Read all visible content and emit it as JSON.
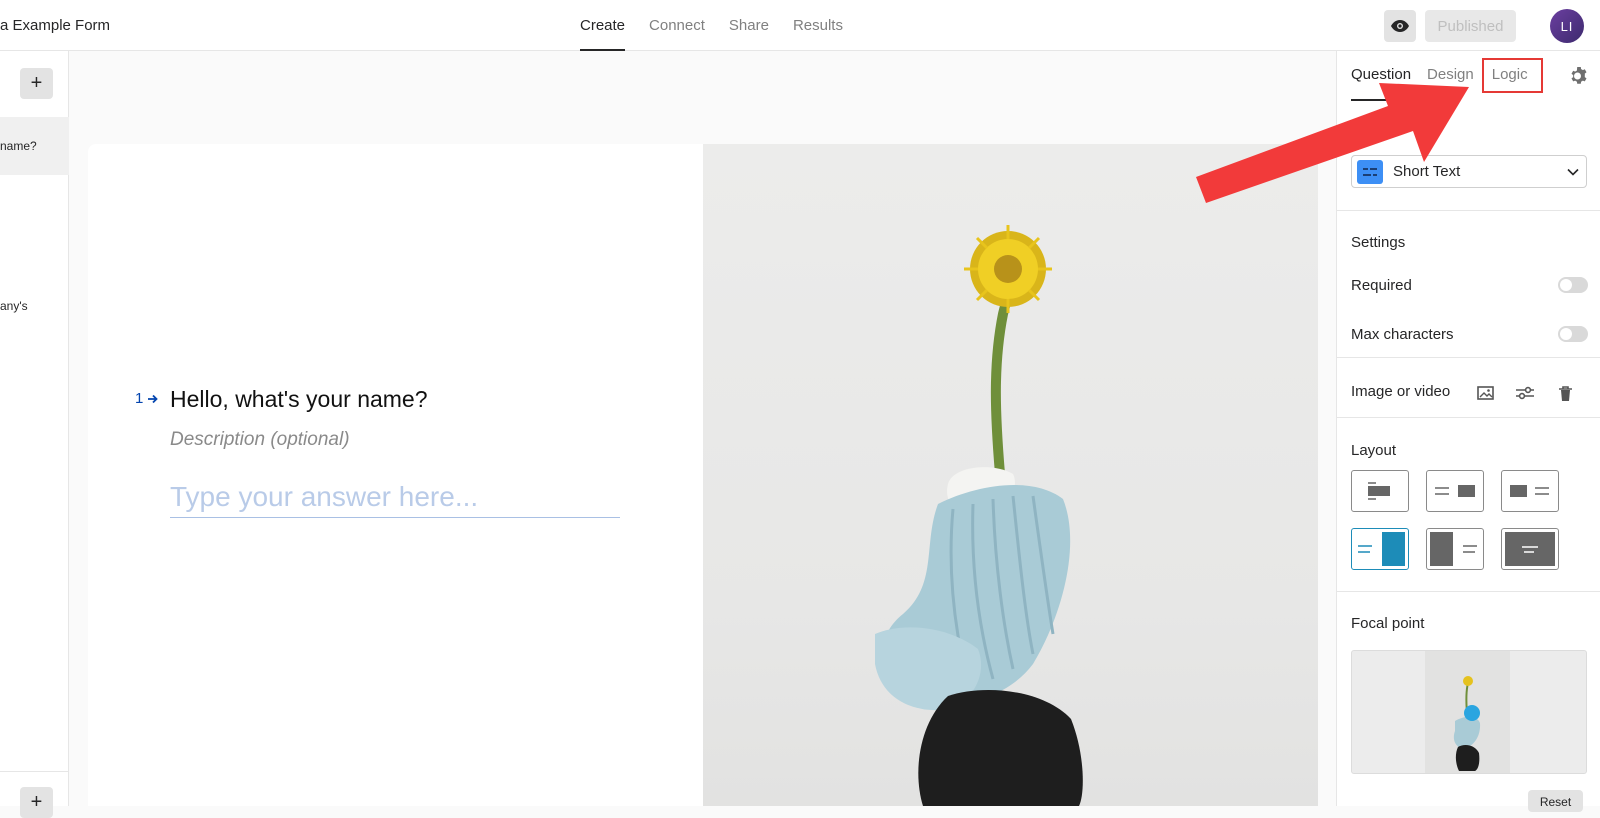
{
  "header": {
    "form_title": "a Example Form",
    "tabs": [
      {
        "label": "Create",
        "active": true
      },
      {
        "label": "Connect",
        "active": false
      },
      {
        "label": "Share",
        "active": false
      },
      {
        "label": "Results",
        "active": false
      }
    ],
    "preview_icon": "eye-icon",
    "published_label": "Published",
    "avatar_initials": "LI"
  },
  "left_sidebar": {
    "add_label": "+",
    "items": [
      {
        "label": "name?",
        "active": true
      },
      {
        "label": "any's",
        "active": false
      }
    ]
  },
  "question": {
    "number": "1",
    "number_icon": "arrow-right-icon",
    "title": "Hello, what's your name?",
    "description": "Description (optional)",
    "answer_placeholder": "Type your answer here..."
  },
  "right_panel": {
    "tabs": [
      {
        "label": "Question",
        "active": true
      },
      {
        "label": "Design",
        "active": false
      },
      {
        "label": "Logic",
        "active": false
      }
    ],
    "settings_icon": "gear-icon",
    "question_type": "Short Text",
    "settings_heading": "Settings",
    "required_label": "Required",
    "required_on": false,
    "max_chars_label": "Max characters",
    "max_chars_on": false,
    "media_label": "Image or video",
    "layout_heading": "Layout",
    "focal_heading": "Focal point",
    "reset_label": "Reset"
  },
  "colors": {
    "accent_blue": "#0445af",
    "annotation_red": "#e53935",
    "layout_selected": "#1d8cb8",
    "short_text_icon_bg": "#3d8ff5"
  }
}
